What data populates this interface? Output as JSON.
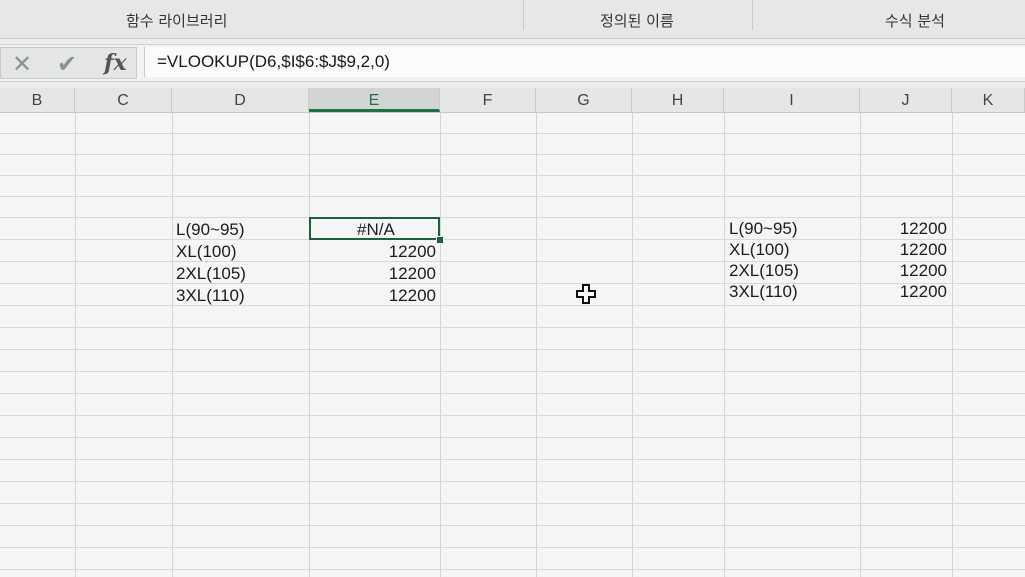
{
  "ribbon": {
    "group1": "함수 라이브러리",
    "group2": "정의된 이름",
    "group3": "수식 분석"
  },
  "formula_bar": {
    "cancel_icon": "close-icon",
    "enter_icon": "check-icon",
    "fx_label": "fx",
    "formula": "=VLOOKUP(D6,$I$6:$J$9,2,0)"
  },
  "columns": [
    "B",
    "C",
    "D",
    "E",
    "F",
    "G",
    "H",
    "I",
    "J",
    "K"
  ],
  "selected_column": "E",
  "cells": {
    "d6": "L(90~95)",
    "d7": "XL(100)",
    "d8": "2XL(105)",
    "d9": "3XL(110)",
    "e6": "#N/A",
    "e7": "12200",
    "e8": "12200",
    "e9": "12200",
    "i6": "L(90~95)",
    "i7": "XL(100)",
    "i8": "2XL(105)",
    "i9": "3XL(110)",
    "j6": "12200",
    "j7": "12200",
    "j8": "12200",
    "j9": "12200"
  }
}
